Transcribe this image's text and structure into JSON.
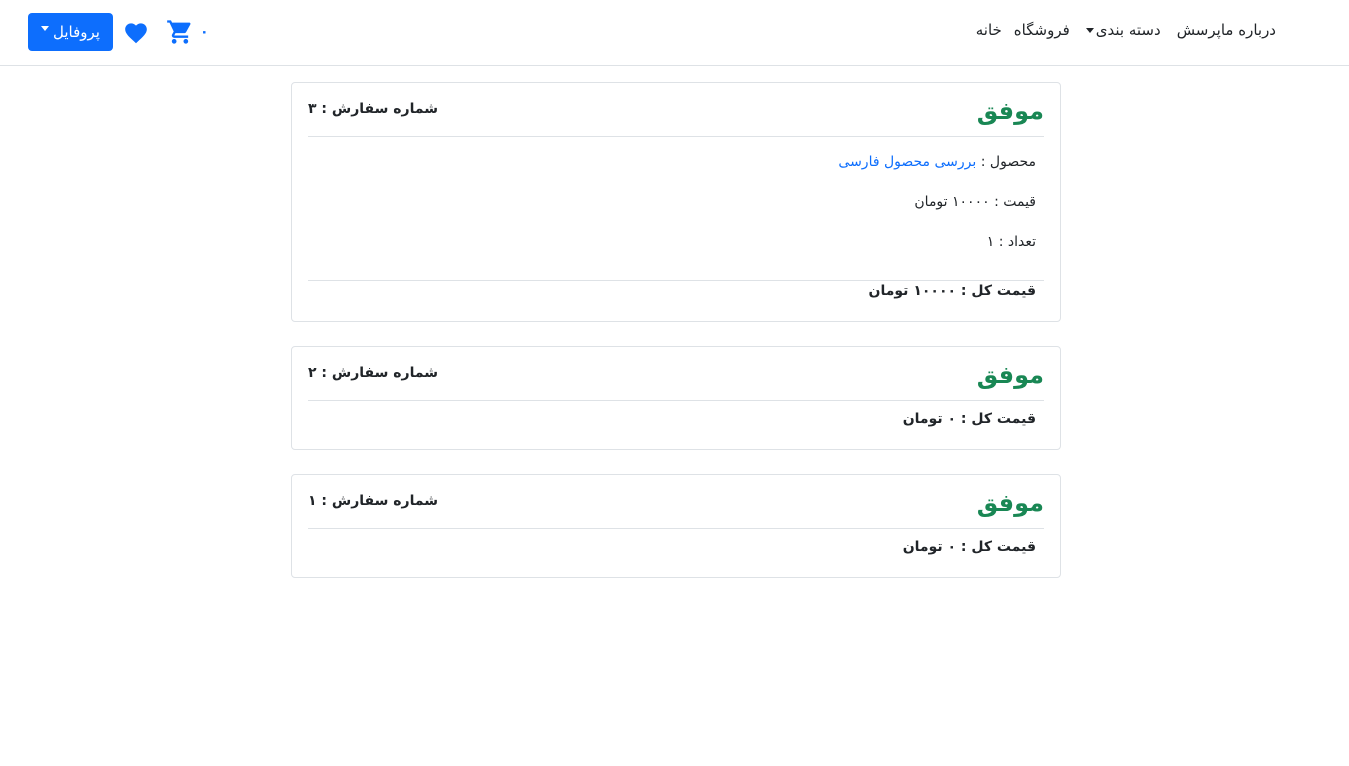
{
  "nav": {
    "items": [
      {
        "label": "خانه"
      },
      {
        "label": "فروشگاه"
      },
      {
        "label": "دسته بندی"
      },
      {
        "label": "پرسش"
      },
      {
        "label": "درباره ما"
      }
    ],
    "profile_label": "پروفایل",
    "cart_count": "۰"
  },
  "colors": {
    "primary": "#0d6efd",
    "success": "#198754"
  },
  "orders": [
    {
      "status": "موفق",
      "order_number_label": "شماره سفارش : ۳",
      "product_label": "محصول :",
      "product_name": "بررسی محصول فارسی",
      "price_label": "قیمت : ۱۰۰۰۰ تومان",
      "quantity_label": "تعداد : ۱",
      "total_label": "قیمت کل : ۱۰۰۰۰ تومان"
    },
    {
      "status": "موفق",
      "order_number_label": "شماره سفارش : ۲",
      "total_label": "قیمت کل : ۰ تومان"
    },
    {
      "status": "موفق",
      "order_number_label": "شماره سفارش : ۱",
      "total_label": "قیمت کل : ۰ تومان"
    }
  ]
}
